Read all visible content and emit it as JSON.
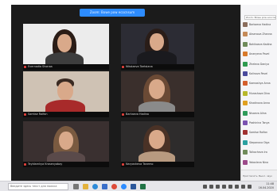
{
  "meeting": {
    "banner_text": "Zoom: Bowe pow ecocnsum"
  },
  "participants": [
    {
      "name": "Evernadia Shonaa",
      "bg": "#eeeeee"
    },
    {
      "name": "Nikolaeva Taetsiana",
      "bg": "#2c2c34"
    },
    {
      "name": "Samtse Raifon",
      "bg": "#4a3a3a"
    },
    {
      "name": "Barkaeva Hadina",
      "bg": "#3a2f2c"
    },
    {
      "name": "Teyldarnkya Krasenyabay",
      "bg": "#3a3030"
    },
    {
      "name": "Naryasheva Tanemo",
      "bg": "#2e2c2c"
    }
  ],
  "panel": {
    "header": "Zoom: Bowe pow ecocnsum",
    "items": [
      {
        "label": "Barkaeva Hadina",
        "color": "#8a6d5c"
      },
      {
        "label": "Aksenova Zhanna",
        "color": "#c58a58"
      },
      {
        "label": "Bahikaeva Kadina",
        "color": "#6f8b5a"
      },
      {
        "label": "Ananyeva Pavel",
        "color": "#d87a2a"
      },
      {
        "label": "Zheleva Daniya",
        "color": "#2f9b4f"
      },
      {
        "label": "Kalinova Pavel",
        "color": "#4a4a9c"
      },
      {
        "label": "Kaenashya Anna",
        "color": "#d45f2c"
      },
      {
        "label": "Murashova Dina",
        "color": "#b8b82a"
      },
      {
        "label": "Khadinova Anna",
        "color": "#e0a020"
      },
      {
        "label": "Nisaeva Alina",
        "color": "#2f9b5a"
      },
      {
        "label": "Pashinina Tanya",
        "color": "#7a52b0"
      },
      {
        "label": "Samtse Raifon",
        "color": "#a03030"
      },
      {
        "label": "Stepanova Olga",
        "color": "#2aa0a0"
      },
      {
        "label": "Tolkacheva Ira",
        "color": "#6f8b5a"
      },
      {
        "label": "Yakovleva Nina",
        "color": "#9c4a8a"
      }
    ],
    "footer_left": "Пригласить",
    "footer_right": "Выкл. звук"
  },
  "taskbar": {
    "search_placeholder": "Введите здесь текст для поиска",
    "clock_time": "11:48",
    "clock_date": "16.04.2020"
  }
}
